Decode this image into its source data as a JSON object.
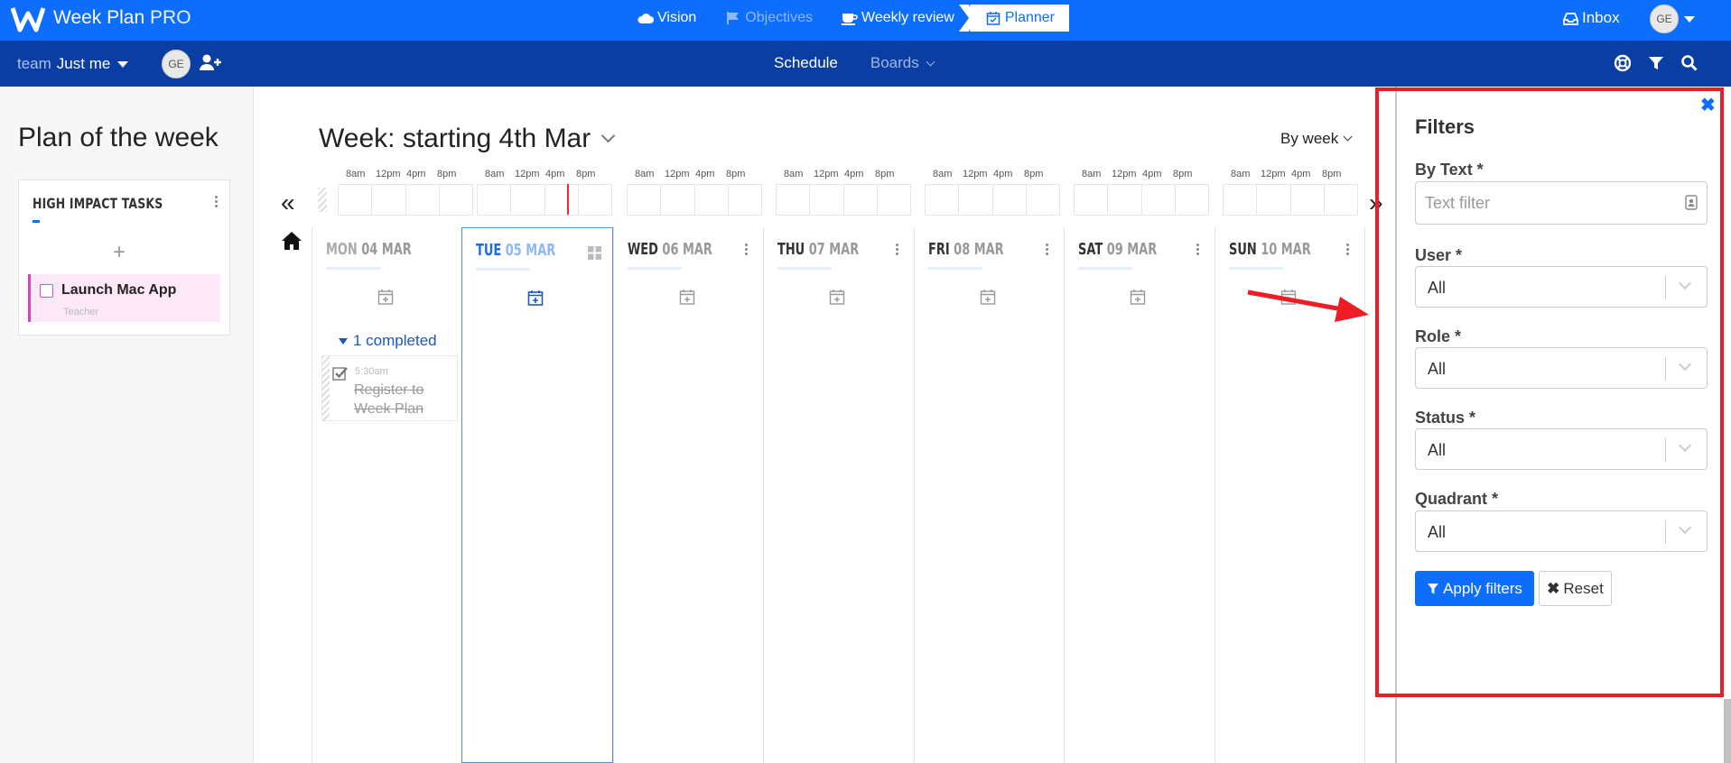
{
  "app": {
    "brand": "Week Plan",
    "edition": "PRO"
  },
  "top_nav": [
    {
      "label": "Vision",
      "icon": "cloud-icon",
      "state": "normal"
    },
    {
      "label": "Objectives",
      "icon": "flag-icon",
      "state": "disabled"
    },
    {
      "label": "Weekly review",
      "icon": "coffee-icon",
      "state": "normal"
    },
    {
      "label": "Planner",
      "icon": "calendar-check-icon",
      "state": "active"
    }
  ],
  "inbox_label": "Inbox",
  "user_initials": "GE",
  "team": {
    "label": "team",
    "value": "Just me",
    "member_initials": "GE"
  },
  "sub_nav": {
    "schedule": "Schedule",
    "boards": "Boards"
  },
  "sidebar": {
    "title": "Plan of the week",
    "high_impact": {
      "title": "HIGH IMPACT TASKS",
      "add_symbol": "+",
      "tasks": [
        {
          "title": "Launch Mac App",
          "subtitle": "Teacher"
        }
      ]
    }
  },
  "week": {
    "title": "Week: starting 4th Mar",
    "view_mode": "By week"
  },
  "timeline_labels": [
    "8am",
    "12pm",
    "4pm",
    "8pm"
  ],
  "days": [
    {
      "name": "MON",
      "date": "04 MAR"
    },
    {
      "name": "TUE",
      "date": "05 MAR",
      "today": true
    },
    {
      "name": "WED",
      "date": "06 MAR"
    },
    {
      "name": "THU",
      "date": "07 MAR"
    },
    {
      "name": "FRI",
      "date": "08 MAR"
    },
    {
      "name": "SAT",
      "date": "09 MAR"
    },
    {
      "name": "SUN",
      "date": "10 MAR"
    }
  ],
  "completed_group": {
    "label": "1 completed",
    "task": {
      "time": "5:30am",
      "title": "Register to Week Plan"
    }
  },
  "filters": {
    "title": "Filters",
    "by_text_label": "By Text *",
    "text_placeholder": "Text filter",
    "user_label": "User *",
    "user_value": "All",
    "role_label": "Role *",
    "role_value": "All",
    "status_label": "Status *",
    "status_value": "All",
    "quadrant_label": "Quadrant *",
    "quadrant_value": "All",
    "apply_label": "Apply filters",
    "reset_label": "Reset"
  },
  "colors": {
    "primary": "#0d6efd",
    "subbar": "#0a3ea3",
    "today": "#1a6df0",
    "task_accent": "#e43ad0",
    "annotation": "#ee1c25"
  }
}
